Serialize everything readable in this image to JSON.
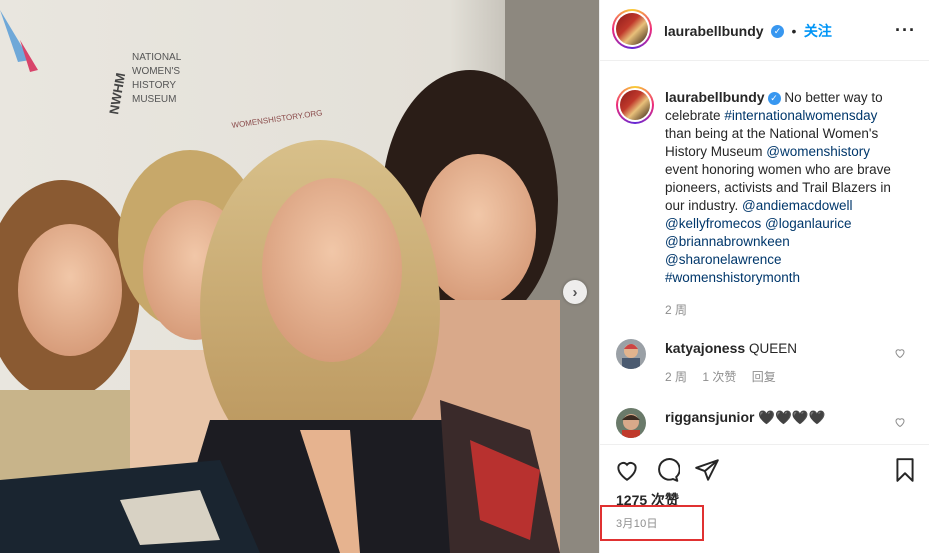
{
  "post": {
    "username": "laurabellbundy",
    "follow_label": "关注",
    "more_icon": "more-options-icon",
    "caption_prefix": "No better way to celebrate",
    "hashtag_1": "#internationalwomensday",
    "caption_middle_1": "than being at the National Women's History Museum",
    "mention_1": "@womenshistory",
    "caption_middle_2": "event honoring women who are brave pioneers, activists and Trail Blazers in our industry.",
    "mention_2": "@andiemacdowell",
    "mention_3": "@kellyfromecos",
    "mention_4": "@loganlaurice",
    "mention_5": "@briannabrownkeen",
    "mention_6": "@sharonelawrence",
    "hashtag_2": "#womenshistorymonth",
    "caption_age": "2 周",
    "likes": "1275 次赞",
    "date": "3月10日"
  },
  "comments": [
    {
      "username": "katyajoness",
      "text": "QUEEN",
      "age": "2 周",
      "likes": "1 次赞",
      "reply_label": "回复"
    },
    {
      "username": "riggansjunior",
      "text": "🖤🖤🖤🖤"
    }
  ],
  "photo": {
    "sign_lines": [
      "NATIONAL",
      "WOMEN'S",
      "HISTORY",
      "MUSEUM"
    ],
    "sign_logo": "NWHM",
    "sign_url": "WOMENSHISTORY.ORG"
  },
  "colors": {
    "link": "#00376b",
    "follow": "#0095f6",
    "verified": "#3897f0",
    "highlight_box": "#e03131"
  }
}
